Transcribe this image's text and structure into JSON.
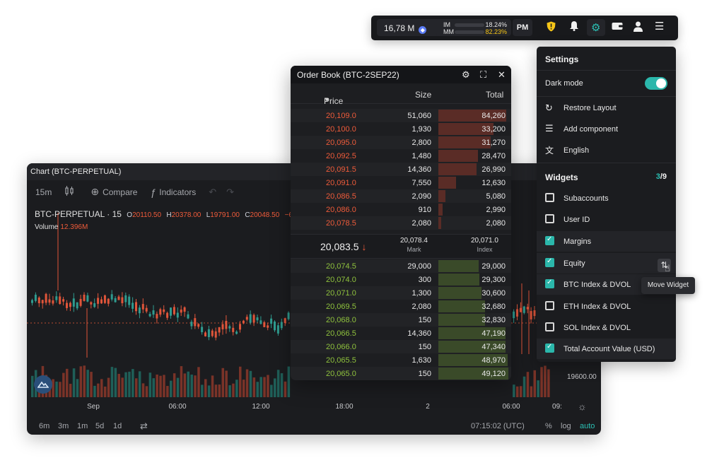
{
  "colors": {
    "accent": "#2bb7ab",
    "down": "#ef5b3a",
    "up": "#8fc23d",
    "background": "#1b1c1f"
  },
  "chart": {
    "title": "Chart (BTC-PERPETUAL)",
    "toolbar": {
      "interval": "15m",
      "compare": "Compare",
      "indicators": "Indicators"
    },
    "legend": {
      "symbol": "BTC-PERPETUAL",
      "sep": "·",
      "resolution": "15",
      "o_label": "O",
      "o_value": "20110.50",
      "h_label": "H",
      "h_value": "20378.00",
      "l_label": "L",
      "l_value": "19791.00",
      "c_label": "C",
      "c_value": "20048.50",
      "change": "−62",
      "volume_label": "Volume",
      "volume_value": "12.396M"
    },
    "time_labels": [
      "Sep",
      "06:00",
      "12:00",
      "18:00",
      "2",
      "06:00",
      "09:"
    ],
    "price_label": "19600.00",
    "timeframes": [
      "6m",
      "3m",
      "1m",
      "5d",
      "1d"
    ],
    "clock": "07:15:02 (UTC)",
    "scale": {
      "percent": "%",
      "log": "log",
      "auto": "auto"
    }
  },
  "orderbook": {
    "title": "Order Book (BTC-2SEP22)",
    "cols": {
      "price": "Price",
      "size": "Size",
      "total": "Total"
    },
    "asks": [
      {
        "price": "20,109.0",
        "size": "51,060",
        "total": "84,260",
        "fill": 0.96
      },
      {
        "price": "20,100.0",
        "size": "1,930",
        "total": "33,200",
        "fill": 0.78
      },
      {
        "price": "20,095.0",
        "size": "2,800",
        "total": "31,270",
        "fill": 0.74
      },
      {
        "price": "20,092.5",
        "size": "1,480",
        "total": "28,470",
        "fill": 0.56
      },
      {
        "price": "20,091.5",
        "size": "14,360",
        "total": "26,990",
        "fill": 0.54
      },
      {
        "price": "20,091.0",
        "size": "7,550",
        "total": "12,630",
        "fill": 0.25
      },
      {
        "price": "20,086.5",
        "size": "2,090",
        "total": "5,080",
        "fill": 0.1
      },
      {
        "price": "20,086.0",
        "size": "910",
        "total": "2,990",
        "fill": 0.06
      },
      {
        "price": "20,078.5",
        "size": "2,080",
        "total": "2,080",
        "fill": 0.04
      }
    ],
    "mid": {
      "last": "20,083.5",
      "mark_value": "20,078.4",
      "mark_label": "Mark",
      "index_value": "20,071.0",
      "index_label": "Index"
    },
    "bids": [
      {
        "price": "20,074.5",
        "size": "29,000",
        "total": "29,000",
        "fill": 0.57
      },
      {
        "price": "20,074.0",
        "size": "300",
        "total": "29,300",
        "fill": 0.58
      },
      {
        "price": "20,071.0",
        "size": "1,300",
        "total": "30,600",
        "fill": 0.61
      },
      {
        "price": "20,069.5",
        "size": "2,080",
        "total": "32,680",
        "fill": 0.66
      },
      {
        "price": "20,068.0",
        "size": "150",
        "total": "32,830",
        "fill": 0.66
      },
      {
        "price": "20,066.5",
        "size": "14,360",
        "total": "47,190",
        "fill": 0.95
      },
      {
        "price": "20,066.0",
        "size": "150",
        "total": "47,340",
        "fill": 0.95
      },
      {
        "price": "20,065.5",
        "size": "1,630",
        "total": "48,970",
        "fill": 0.98
      },
      {
        "price": "20,065.0",
        "size": "150",
        "total": "49,120",
        "fill": 0.99
      }
    ]
  },
  "topbar": {
    "balance": "16,78 M",
    "im_label": "IM",
    "im_pct": "18.24%",
    "im_fill": 0.18,
    "mm_label": "MM",
    "mm_pct": "82.23%",
    "mm_fill": 0.82,
    "pm": "PM"
  },
  "settings": {
    "title": "Settings",
    "dark_mode": "Dark mode",
    "restore": "Restore Layout",
    "add": "Add component",
    "language": "English",
    "widgets_title": "Widgets",
    "widgets_active": "3",
    "widgets_sep": "/",
    "widgets_total": "9",
    "widgets": [
      {
        "label": "Subaccounts",
        "checked": false
      },
      {
        "label": "User ID",
        "checked": false
      },
      {
        "label": "Margins",
        "checked": true
      },
      {
        "label": "Equity",
        "checked": true
      },
      {
        "label": "BTC Index & DVOL",
        "checked": true
      },
      {
        "label": "ETH Index & DVOL",
        "checked": false
      },
      {
        "label": "SOL Index & DVOL",
        "checked": false
      },
      {
        "label": "Total Account Value (USD)",
        "checked": true
      }
    ],
    "tooltip": "Move Widget"
  }
}
